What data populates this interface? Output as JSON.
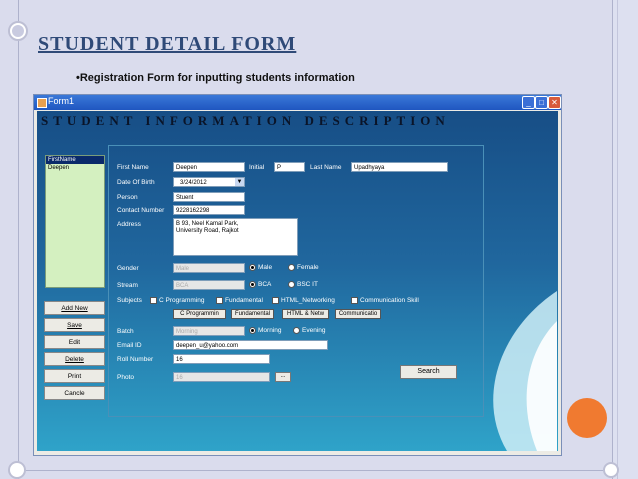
{
  "slide": {
    "title": "STUDENT DETAIL FORM",
    "bullet": "•Registration Form for inputting students information"
  },
  "window": {
    "title": "Form1",
    "controls": {
      "minimize": "_",
      "maximize": "□",
      "close": "✕"
    },
    "banner": "STUDENT INFORMATION DESCRIPTION"
  },
  "left_panel": {
    "header": "FirstName",
    "items": [
      "Deepen"
    ]
  },
  "side_buttons": {
    "add_new": "Add New",
    "save": "Save",
    "edit": "Edit",
    "delete": "Delete",
    "print": "Print",
    "cancel": "Cancle"
  },
  "form": {
    "first_name_label": "First Name",
    "first_name_value": "Deepen",
    "initial_label": "Initial",
    "initial_value": "P",
    "last_name_label": "Last Name",
    "last_name_value": "Upadhyaya",
    "dob_label": "Date Of Birth",
    "dob_value": "3/24/2012",
    "person_label": "Person",
    "person_value": "Stuent",
    "contact_label": "Contact Number",
    "contact_value": "9228162298",
    "address_label": "Address",
    "address_line1": "B 93, Neel Kamal Park,",
    "address_line2": "University Road, Rajkot",
    "gender_label": "Gender",
    "gender_value": "Male",
    "gender_male": "Male",
    "gender_female": "Female",
    "stream_label": "Stream",
    "stream_value": "BCA",
    "stream_bca": "BCA",
    "stream_bscit": "BSC IT",
    "subjects_label": "Subjects",
    "subject_c": "C Programming",
    "subject_fund": "Fundamental",
    "subject_html": "HTML_Networking",
    "subject_comm": "Communication Skill",
    "subject_btn_c": "C Programmin",
    "subject_btn_fund": "Fundamental",
    "subject_btn_html": "HTML & Netw",
    "subject_btn_comm": "Communicatio",
    "batch_label": "Batch",
    "batch_value": "Morning",
    "batch_morning": "Morning",
    "batch_evening": "Evening",
    "email_label": "Email ID",
    "email_value": "deepen_u@yahoo.com",
    "roll_label": "Roll Number",
    "roll_value": "16",
    "photo_label": "Photo",
    "photo_value": "16",
    "photo_browse": "...",
    "search_button": "Search"
  },
  "colors": {
    "slide_title": "#2f4a78",
    "titlebar": "#1f56c0",
    "client_top": "#174e86",
    "client_bottom": "#2fa3c9",
    "orange_dot": "#f07a30"
  }
}
